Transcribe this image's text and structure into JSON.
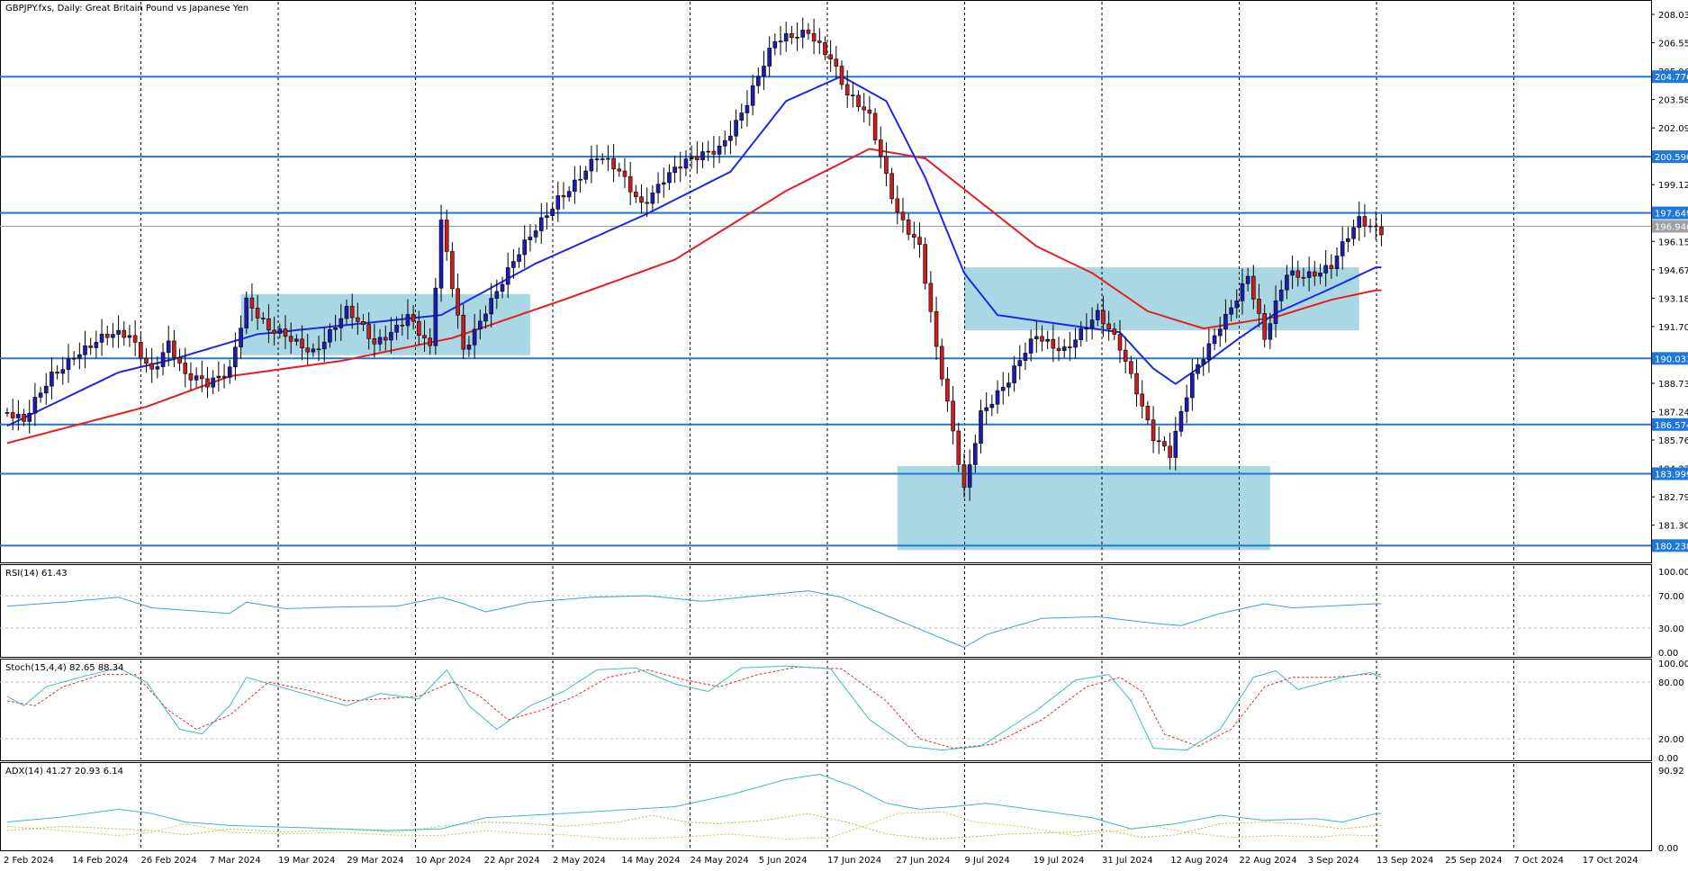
{
  "chart_title": "GBPJPY.fxs, Daily:  Great Britain Pound vs Japanese Yen",
  "colors": {
    "bull": "#1c1cb0",
    "bear": "#c81e1e",
    "ma_fast": "#1e28e6",
    "ma_slow": "#e61e1e",
    "level": "#1e78dc",
    "zone": "#a9d8e4",
    "rsi": "#3aa0e0",
    "stoch_main": "#3cbcc8",
    "stoch_signal": "#e03030",
    "adx": "#40b8c0",
    "di_plus": "#a8c830",
    "di_minus": "#e0c040"
  },
  "chart_data": [
    {
      "type": "candlestick",
      "name": "price",
      "ylim": [
        179.5,
        208.6
      ],
      "y_ticks": [
        "208.035",
        "206.550",
        "205.065",
        "203.580",
        "202.095",
        "200.610",
        "199.125",
        "197.640",
        "196.155",
        "194.670",
        "193.185",
        "191.700",
        "190.215",
        "188.730",
        "187.245",
        "185.760",
        "184.275",
        "182.790",
        "181.305"
      ],
      "y_tick_values": [
        208.035,
        206.55,
        205.065,
        203.58,
        202.095,
        200.61,
        199.125,
        197.64,
        196.155,
        194.67,
        193.185,
        191.7,
        190.215,
        188.73,
        187.245,
        185.76,
        184.275,
        182.79,
        181.305
      ],
      "x_labels": [
        "2 Feb 2024",
        "14 Feb 2024",
        "26 Feb 2024",
        "7 Mar 2024",
        "19 Mar 2024",
        "29 Mar 2024",
        "10 Apr 2024",
        "22 Apr 2024",
        "2 May 2024",
        "14 May 2024",
        "24 May 2024",
        "5 Jun 2024",
        "17 Jun 2024",
        "27 Jun 2024",
        "9 Jul 2024",
        "19 Jul 2024",
        "31 Jul 2024",
        "12 Aug 2024",
        "22 Aug 2024",
        "3 Sep 2024",
        "13 Sep 2024",
        "25 Sep 2024",
        "7 Oct 2024",
        "17 Oct 2024"
      ],
      "levels": [
        204.776,
        200.59,
        197.649,
        190.033,
        186.574,
        183.999,
        180.238
      ],
      "level_labels": [
        "204.776",
        "200.590",
        "197.649",
        "190.033",
        "186.574",
        "183.999",
        "180.238"
      ],
      "current_price": 196.946,
      "current_price_label": "196.946",
      "zones": [
        {
          "from_bar": 42,
          "to_bar": 94,
          "high": 193.4,
          "low": 190.2
        },
        {
          "from_bar": 172,
          "to_bar": 243,
          "high": 194.8,
          "low": 191.5
        },
        {
          "from_bar": 160,
          "to_bar": 227,
          "high": 184.4,
          "low": 180.0
        }
      ],
      "anchors": [
        [
          0,
          187.2
        ],
        [
          3,
          186.5
        ],
        [
          8,
          189.2
        ],
        [
          12,
          190.4
        ],
        [
          18,
          191.0
        ],
        [
          22,
          191.2
        ],
        [
          26,
          189.6
        ],
        [
          29,
          190.9
        ],
        [
          32,
          188.9
        ],
        [
          36,
          188.6
        ],
        [
          40,
          189.7
        ],
        [
          43,
          193.2
        ],
        [
          47,
          191.3
        ],
        [
          55,
          190.6
        ],
        [
          61,
          192.4
        ],
        [
          66,
          190.7
        ],
        [
          72,
          192.5
        ],
        [
          76,
          190.4
        ],
        [
          78,
          196.9
        ],
        [
          82,
          190.5
        ],
        [
          86,
          192.8
        ],
        [
          94,
          196.2
        ],
        [
          99,
          198.6
        ],
        [
          106,
          200.4
        ],
        [
          110,
          199.7
        ],
        [
          114,
          198.3
        ],
        [
          118,
          199.5
        ],
        [
          124,
          200.4
        ],
        [
          128,
          201.2
        ],
        [
          133,
          203.5
        ],
        [
          138,
          206.4
        ],
        [
          144,
          207.4
        ],
        [
          148,
          205.8
        ],
        [
          151,
          203.6
        ],
        [
          155,
          202.6
        ],
        [
          160,
          197.9
        ],
        [
          164,
          195.8
        ],
        [
          167,
          190.3
        ],
        [
          172,
          183.3
        ],
        [
          175,
          187.4
        ],
        [
          180,
          188.7
        ],
        [
          185,
          191.2
        ],
        [
          190,
          190.7
        ],
        [
          196,
          192.1
        ],
        [
          200,
          190.6
        ],
        [
          203,
          188.6
        ],
        [
          206,
          186.1
        ],
        [
          209,
          184.9
        ],
        [
          213,
          188.9
        ],
        [
          218,
          192.0
        ],
        [
          223,
          194.3
        ],
        [
          226,
          190.8
        ],
        [
          230,
          194.5
        ],
        [
          238,
          194.8
        ],
        [
          243,
          197.1
        ],
        [
          246,
          196.9
        ]
      ],
      "ma_fast_anchors": [
        [
          0,
          186.5
        ],
        [
          20,
          189.3
        ],
        [
          30,
          190.0
        ],
        [
          45,
          191.3
        ],
        [
          65,
          191.9
        ],
        [
          78,
          192.3
        ],
        [
          95,
          195.0
        ],
        [
          115,
          197.6
        ],
        [
          130,
          199.8
        ],
        [
          140,
          203.5
        ],
        [
          150,
          204.8
        ],
        [
          158,
          203.5
        ],
        [
          165,
          199.5
        ],
        [
          172,
          194.5
        ],
        [
          178,
          192.3
        ],
        [
          190,
          191.8
        ],
        [
          200,
          191.4
        ],
        [
          206,
          189.5
        ],
        [
          210,
          188.7
        ],
        [
          215,
          189.7
        ],
        [
          221,
          191.0
        ],
        [
          228,
          192.4
        ],
        [
          238,
          193.7
        ],
        [
          246,
          194.8
        ]
      ],
      "ma_slow_anchors": [
        [
          0,
          185.6
        ],
        [
          25,
          187.5
        ],
        [
          40,
          189.1
        ],
        [
          60,
          189.9
        ],
        [
          80,
          191.1
        ],
        [
          100,
          193.1
        ],
        [
          120,
          195.2
        ],
        [
          140,
          198.8
        ],
        [
          155,
          201.0
        ],
        [
          165,
          200.5
        ],
        [
          175,
          198.2
        ],
        [
          185,
          195.9
        ],
        [
          195,
          194.5
        ],
        [
          205,
          192.5
        ],
        [
          215,
          191.6
        ],
        [
          228,
          192.2
        ],
        [
          238,
          193.1
        ],
        [
          246,
          193.6
        ]
      ]
    },
    {
      "type": "line",
      "name": "RSI(14)",
      "label": "RSI(14) 61.43",
      "ylim": [
        0,
        100
      ],
      "y_ticks": [
        "100.00",
        "70.00",
        "30.00",
        "0.00"
      ],
      "y_tick_values": [
        100,
        70,
        30,
        0
      ],
      "guide_levels": [
        70,
        30
      ],
      "anchors": [
        [
          0,
          57
        ],
        [
          10,
          62
        ],
        [
          20,
          68
        ],
        [
          26,
          55
        ],
        [
          32,
          52
        ],
        [
          40,
          48
        ],
        [
          43,
          62
        ],
        [
          50,
          54
        ],
        [
          60,
          56
        ],
        [
          70,
          57
        ],
        [
          78,
          68
        ],
        [
          82,
          60
        ],
        [
          86,
          50
        ],
        [
          94,
          62
        ],
        [
          105,
          68
        ],
        [
          115,
          70
        ],
        [
          125,
          63
        ],
        [
          135,
          70
        ],
        [
          144,
          76
        ],
        [
          150,
          68
        ],
        [
          160,
          40
        ],
        [
          172,
          6
        ],
        [
          176,
          22
        ],
        [
          186,
          42
        ],
        [
          196,
          44
        ],
        [
          206,
          36
        ],
        [
          211,
          33
        ],
        [
          218,
          48
        ],
        [
          226,
          60
        ],
        [
          231,
          55
        ],
        [
          240,
          58
        ],
        [
          246,
          60
        ]
      ]
    },
    {
      "type": "line",
      "name": "Stoch(15,4,4)",
      "label": "Stoch(15,4,4) 82.65 88.34",
      "ylim": [
        0,
        100
      ],
      "y_ticks": [
        "100.00",
        "80.00",
        "20.00",
        "0.00"
      ],
      "y_tick_values": [
        100,
        80,
        20,
        0
      ],
      "guide_levels": [
        80,
        20
      ],
      "main_anchors": [
        [
          0,
          65
        ],
        [
          3,
          55
        ],
        [
          7,
          75
        ],
        [
          13,
          85
        ],
        [
          20,
          95
        ],
        [
          25,
          80
        ],
        [
          31,
          30
        ],
        [
          35,
          25
        ],
        [
          40,
          55
        ],
        [
          43,
          85
        ],
        [
          49,
          75
        ],
        [
          55,
          65
        ],
        [
          61,
          55
        ],
        [
          67,
          68
        ],
        [
          74,
          62
        ],
        [
          79,
          93
        ],
        [
          83,
          55
        ],
        [
          88,
          30
        ],
        [
          94,
          55
        ],
        [
          100,
          70
        ],
        [
          106,
          93
        ],
        [
          113,
          95
        ],
        [
          120,
          78
        ],
        [
          126,
          70
        ],
        [
          132,
          95
        ],
        [
          140,
          97
        ],
        [
          148,
          94
        ],
        [
          155,
          40
        ],
        [
          162,
          12
        ],
        [
          168,
          8
        ],
        [
          175,
          12
        ],
        [
          185,
          50
        ],
        [
          192,
          82
        ],
        [
          198,
          88
        ],
        [
          202,
          60
        ],
        [
          206,
          10
        ],
        [
          212,
          8
        ],
        [
          218,
          30
        ],
        [
          224,
          85
        ],
        [
          228,
          92
        ],
        [
          232,
          72
        ],
        [
          240,
          85
        ],
        [
          245,
          90
        ],
        [
          247,
          85
        ]
      ],
      "signal_anchors": [
        [
          0,
          60
        ],
        [
          5,
          55
        ],
        [
          10,
          75
        ],
        [
          17,
          88
        ],
        [
          23,
          88
        ],
        [
          29,
          50
        ],
        [
          34,
          30
        ],
        [
          40,
          45
        ],
        [
          47,
          80
        ],
        [
          55,
          70
        ],
        [
          61,
          60
        ],
        [
          67,
          62
        ],
        [
          74,
          65
        ],
        [
          80,
          80
        ],
        [
          85,
          65
        ],
        [
          90,
          40
        ],
        [
          96,
          50
        ],
        [
          102,
          65
        ],
        [
          108,
          85
        ],
        [
          115,
          93
        ],
        [
          122,
          82
        ],
        [
          128,
          75
        ],
        [
          135,
          88
        ],
        [
          142,
          96
        ],
        [
          150,
          94
        ],
        [
          158,
          60
        ],
        [
          164,
          20
        ],
        [
          170,
          10
        ],
        [
          177,
          14
        ],
        [
          186,
          40
        ],
        [
          194,
          75
        ],
        [
          200,
          85
        ],
        [
          204,
          70
        ],
        [
          208,
          25
        ],
        [
          214,
          12
        ],
        [
          220,
          30
        ],
        [
          226,
          75
        ],
        [
          231,
          85
        ],
        [
          238,
          85
        ],
        [
          244,
          88
        ],
        [
          247,
          88
        ]
      ]
    },
    {
      "type": "line",
      "name": "ADX(14)",
      "label": "ADX(14) 41.27 20.93 6.14",
      "ylim": [
        0,
        95
      ],
      "y_ticks": [
        "90.92",
        "0.00"
      ],
      "y_tick_values": [
        90.92,
        0
      ],
      "adx_anchors": [
        [
          0,
          30
        ],
        [
          10,
          36
        ],
        [
          20,
          45
        ],
        [
          26,
          40
        ],
        [
          32,
          30
        ],
        [
          40,
          26
        ],
        [
          50,
          24
        ],
        [
          60,
          22
        ],
        [
          68,
          20
        ],
        [
          78,
          22
        ],
        [
          86,
          35
        ],
        [
          94,
          38
        ],
        [
          100,
          40
        ],
        [
          110,
          44
        ],
        [
          120,
          48
        ],
        [
          130,
          62
        ],
        [
          140,
          80
        ],
        [
          146,
          86
        ],
        [
          152,
          72
        ],
        [
          158,
          52
        ],
        [
          164,
          45
        ],
        [
          170,
          48
        ],
        [
          176,
          52
        ],
        [
          185,
          44
        ],
        [
          195,
          35
        ],
        [
          202,
          22
        ],
        [
          210,
          28
        ],
        [
          218,
          38
        ],
        [
          226,
          32
        ],
        [
          235,
          34
        ],
        [
          240,
          30
        ],
        [
          246,
          40
        ]
      ],
      "di_plus_anchors": [
        [
          0,
          20
        ],
        [
          10,
          25
        ],
        [
          20,
          22
        ],
        [
          26,
          20
        ],
        [
          32,
          15
        ],
        [
          40,
          22
        ],
        [
          50,
          18
        ],
        [
          60,
          22
        ],
        [
          70,
          18
        ],
        [
          78,
          25
        ],
        [
          86,
          30
        ],
        [
          94,
          28
        ],
        [
          100,
          25
        ],
        [
          110,
          30
        ],
        [
          116,
          38
        ],
        [
          122,
          30
        ],
        [
          128,
          28
        ],
        [
          136,
          32
        ],
        [
          144,
          40
        ],
        [
          152,
          28
        ],
        [
          158,
          16
        ],
        [
          166,
          10
        ],
        [
          172,
          12
        ],
        [
          180,
          16
        ],
        [
          190,
          18
        ],
        [
          198,
          20
        ],
        [
          204,
          12
        ],
        [
          210,
          15
        ],
        [
          218,
          28
        ],
        [
          226,
          30
        ],
        [
          232,
          28
        ],
        [
          240,
          22
        ],
        [
          246,
          26
        ]
      ],
      "di_minus_anchors": [
        [
          0,
          25
        ],
        [
          10,
          20
        ],
        [
          20,
          14
        ],
        [
          26,
          18
        ],
        [
          32,
          28
        ],
        [
          40,
          18
        ],
        [
          50,
          16
        ],
        [
          60,
          18
        ],
        [
          68,
          15
        ],
        [
          78,
          14
        ],
        [
          86,
          20
        ],
        [
          94,
          16
        ],
        [
          100,
          15
        ],
        [
          110,
          10
        ],
        [
          120,
          12
        ],
        [
          130,
          16
        ],
        [
          140,
          10
        ],
        [
          148,
          12
        ],
        [
          154,
          25
        ],
        [
          160,
          40
        ],
        [
          168,
          42
        ],
        [
          174,
          30
        ],
        [
          182,
          25
        ],
        [
          192,
          14
        ],
        [
          200,
          20
        ],
        [
          206,
          25
        ],
        [
          212,
          18
        ],
        [
          220,
          12
        ],
        [
          228,
          14
        ],
        [
          236,
          12
        ],
        [
          240,
          15
        ],
        [
          246,
          14
        ]
      ]
    }
  ]
}
